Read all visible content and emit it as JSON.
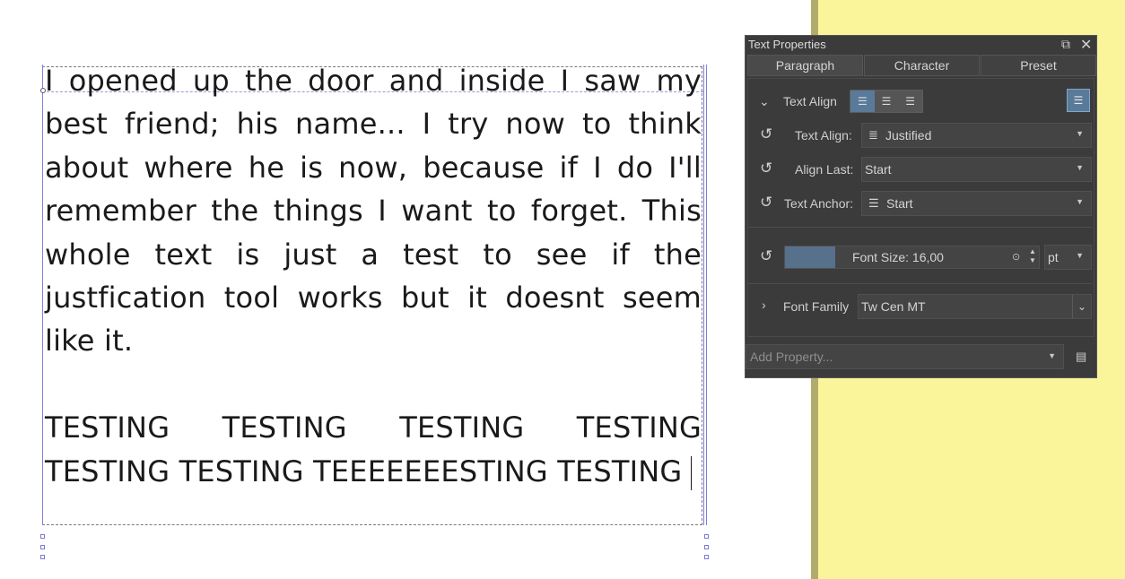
{
  "document": {
    "paragraph1": "I opened up the door and inside I saw my best friend; his name... I try now to think about where he is now, because if I do I'll remember the things I want to forget. This whole text is just a test to see if the justfication tool works but it doesnt seem like it.",
    "paragraph2": "TESTING TESTING TESTING TESTING TESTING TESTING TEEEEEEESTING TESTING"
  },
  "panel": {
    "title": "Text Properties",
    "tabs": [
      "Paragraph",
      "Character",
      "Preset"
    ],
    "active_tab": "Paragraph",
    "text_align_section": "Text Align",
    "text_align_label": "Text Align:",
    "text_align_value": "Justified",
    "align_last_label": "Align Last:",
    "align_last_value": "Start",
    "text_anchor_label": "Text Anchor:",
    "text_anchor_value": "Start",
    "font_size_text": "Font Size: 16,00",
    "font_size_unit": "pt",
    "font_family_label": "Font Family",
    "font_family_value": "Tw Cen MT",
    "add_property_placeholder": "Add Property..."
  },
  "colors": {
    "canvas_yellow": "#faf59a",
    "panel_bg": "#3b3b3b",
    "accent": "#5a7a9a"
  },
  "icons": [
    "float-icon",
    "close-icon",
    "chevron-down-icon",
    "align-left-icon",
    "align-center-icon",
    "align-right-icon",
    "justify-icon",
    "reset-icon",
    "chevron-right-icon",
    "dropdown-arrow-icon",
    "menu-icon"
  ]
}
